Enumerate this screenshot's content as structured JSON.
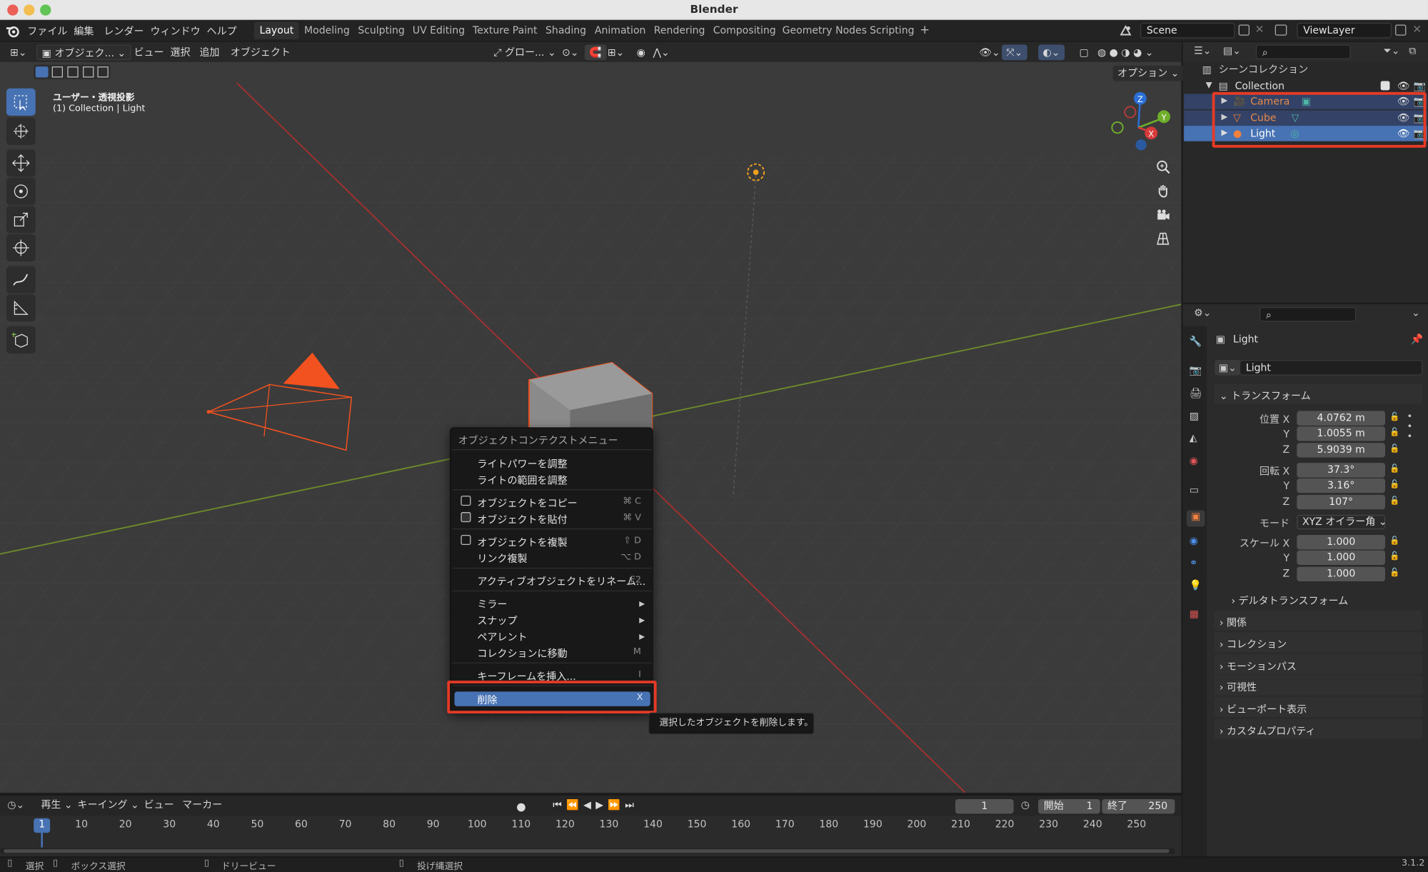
{
  "window": {
    "title": "Blender",
    "version": "3.1.2"
  },
  "menubar": {
    "items": [
      "ファイル",
      "編集",
      "レンダー",
      "ウィンドウ",
      "ヘルプ"
    ]
  },
  "workspaces": {
    "tabs": [
      "Layout",
      "Modeling",
      "Sculpting",
      "UV Editing",
      "Texture Paint",
      "Shading",
      "Animation",
      "Rendering",
      "Compositing",
      "Geometry Nodes",
      "Scripting"
    ],
    "active": "Layout",
    "add": "+"
  },
  "scene": {
    "name": "Scene",
    "view_layer": "ViewLayer"
  },
  "viewport": {
    "mode": "オブジェク...",
    "menus": [
      "ビュー",
      "選択",
      "追加",
      "オブジェクト"
    ],
    "transform_orientation": "グロー...",
    "options": "オプション",
    "overlay_text": {
      "projection": "ユーザー・透視投影",
      "active": "(1) Collection | Light"
    }
  },
  "context_menu": {
    "title": "オブジェクトコンテクストメニュー",
    "items": [
      {
        "label": "ライトパワーを調整",
        "shortcut": ""
      },
      {
        "label": "ライトの範囲を調整",
        "shortcut": ""
      },
      {
        "label": "オブジェクトをコピー",
        "shortcut": "⌘ C"
      },
      {
        "label": "オブジェクトを貼付",
        "shortcut": "⌘ V"
      },
      {
        "label": "オブジェクトを複製",
        "shortcut": "⇧ D"
      },
      {
        "label": "リンク複製",
        "shortcut": "⌥ D"
      },
      {
        "label": "アクティブオブジェクトをリネーム...",
        "shortcut": "F2"
      },
      {
        "label": "ミラー",
        "shortcut": ""
      },
      {
        "label": "スナップ",
        "shortcut": ""
      },
      {
        "label": "ペアレント",
        "shortcut": ""
      },
      {
        "label": "コレクションに移動",
        "shortcut": "M"
      },
      {
        "label": "キーフレームを挿入...",
        "shortcut": "I"
      },
      {
        "label": "削除",
        "shortcut": "X"
      }
    ],
    "tooltip": "選択したオブジェクトを削除します。"
  },
  "outliner": {
    "root": "シーンコレクション",
    "collection": "Collection",
    "objects": [
      {
        "name": "Camera",
        "color": "#e88a4a"
      },
      {
        "name": "Cube",
        "color": "#e88a4a"
      },
      {
        "name": "Light",
        "color": "#ffffff"
      }
    ]
  },
  "properties": {
    "object_name": "Light",
    "datablock": "Light",
    "transform_header": "トランスフォーム",
    "location_label": "位置 X",
    "rotation_label": "回転 X",
    "scale_label": "スケール X",
    "axes": [
      "Y",
      "Z"
    ],
    "location": [
      "4.0762 m",
      "1.0055 m",
      "5.9039 m"
    ],
    "rotation": [
      "37.3°",
      "3.16°",
      "107°"
    ],
    "mode_label": "モード",
    "mode_value": "XYZ オイラー角",
    "scale": [
      "1.000",
      "1.000",
      "1.000"
    ],
    "delta": "デルタトランスフォーム",
    "sections": [
      "関係",
      "コレクション",
      "モーションパス",
      "可視性",
      "ビューポート表示",
      "カスタムプロパティ"
    ]
  },
  "timeline": {
    "menus": [
      "再生",
      "キーイング",
      "ビュー",
      "マーカー"
    ],
    "current_frame": "1",
    "start_label": "開始",
    "start": "1",
    "end_label": "終了",
    "end": "250",
    "ticks": [
      "1",
      "10",
      "20",
      "30",
      "40",
      "50",
      "60",
      "70",
      "80",
      "90",
      "100",
      "110",
      "120",
      "130",
      "140",
      "150",
      "160",
      "170",
      "180",
      "190",
      "200",
      "210",
      "220",
      "230",
      "240",
      "250"
    ]
  },
  "statusbar": {
    "items": [
      "選択",
      "ボックス選択",
      "ドリービュー",
      "投げ縄選択"
    ]
  },
  "colors": {
    "accent": "#4772b3",
    "highlight": "#e53a26",
    "selection_orange": "#ff6b2b",
    "grid_red": "#b03030",
    "grid_green": "#6a8a2a"
  }
}
